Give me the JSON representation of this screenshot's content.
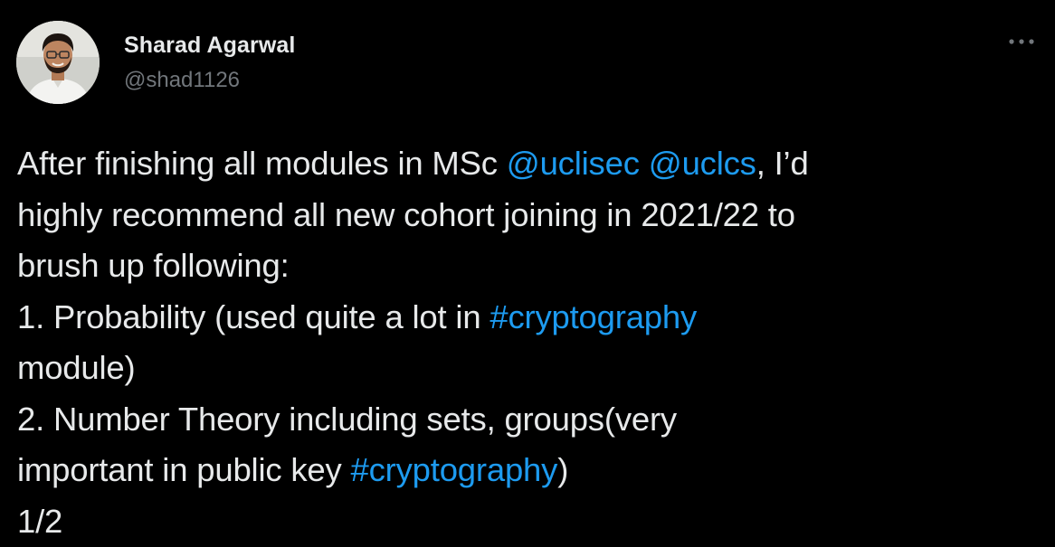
{
  "author": {
    "display_name": "Sharad Agarwal",
    "handle": "@shad1126",
    "avatar_icon": "profile-photo"
  },
  "more_icon": "more-horizontal-icon",
  "colors": {
    "background": "#000000",
    "text": "#e7e9ea",
    "secondary_text": "#71767b",
    "link": "#1d9bf0"
  },
  "tweet": {
    "line1": {
      "part1": "After finishing all modules in MSc ",
      "mention1": "@uclisec",
      "space": " ",
      "mention2": "@uclcs",
      "part2": ", I’d"
    },
    "line2": "highly recommend all new cohort joining in 2021/22 to",
    "line3": "brush up following:",
    "line4": {
      "part1": "1. Probability (used quite a lot in ",
      "hashtag": "#cryptography"
    },
    "line5": "module)",
    "line6": "2. Number Theory including sets, groups(very",
    "line7": {
      "part1": "important in public key ",
      "hashtag": "#cryptography",
      "part2": ")"
    },
    "line8": "1/2"
  }
}
